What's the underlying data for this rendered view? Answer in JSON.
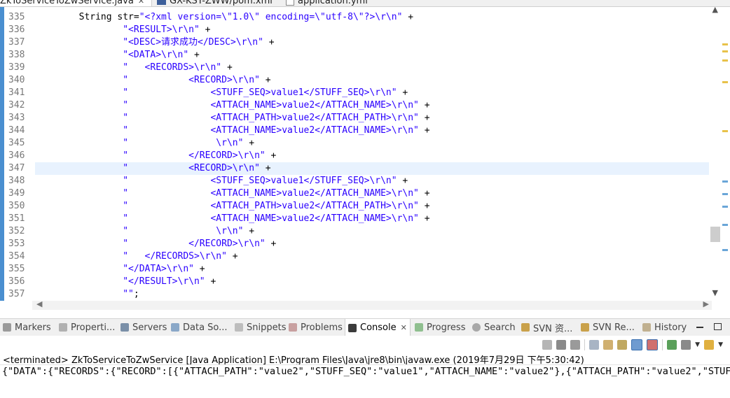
{
  "editor_tabs": [
    {
      "label": "ZkToServiceToZwService.java",
      "active": true
    },
    {
      "label": "GX-KSY-ZWW/pom.xml",
      "active": false
    },
    {
      "label": "application.yml",
      "active": false
    }
  ],
  "colors": {
    "string": "#2a00ff",
    "ruler": "#4a8fd0",
    "current_line": "#e8f2fe"
  },
  "line_numbers": [
    "335",
    "336",
    "337",
    "338",
    "339",
    "340",
    "341",
    "342",
    "343",
    "344",
    "345",
    "346",
    "347",
    "348",
    "349",
    "350",
    "351",
    "352",
    "353",
    "354",
    "355",
    "356",
    "357"
  ],
  "code": {
    "l335": {
      "pre": "        String str=",
      "str": "\"<?xml version=\\\"1.0\\\" encoding=\\\"utf-8\\\"?>\\r\\n\"",
      "post": " +"
    },
    "l336": {
      "pre": "                ",
      "str": "\"<RESULT>\\r\\n\"",
      "post": " +"
    },
    "l337": {
      "pre": "                ",
      "str": "\"<DESC>请求成功</DESC>\\r\\n\"",
      "post": " +"
    },
    "l338": {
      "pre": "                ",
      "str": "\"<DATA>\\r\\n\"",
      "post": " +"
    },
    "l339": {
      "pre": "                ",
      "str": "\"   <RECORDS>\\r\\n\"",
      "post": " +"
    },
    "l340": {
      "pre": "                ",
      "str": "\"           <RECORD>\\r\\n\"",
      "post": " +"
    },
    "l341": {
      "pre": "                ",
      "str": "\"               <STUFF_SEQ>value1</STUFF_SEQ>\\r\\n\"",
      "post": " +"
    },
    "l342": {
      "pre": "                ",
      "str": "\"               <ATTACH_NAME>value2</ATTACH_NAME>\\r\\n\"",
      "post": " +"
    },
    "l343": {
      "pre": "                ",
      "str": "\"               <ATTACH_PATH>value2</ATTACH_PATH>\\r\\n\"",
      "post": " +"
    },
    "l344": {
      "pre": "                ",
      "str": "\"               <ATTACH_NAME>value2</ATTACH_NAME>\\r\\n\"",
      "post": " +"
    },
    "l345": {
      "pre": "                ",
      "str": "\"                \\r\\n\"",
      "post": " +"
    },
    "l346": {
      "pre": "                ",
      "str": "\"           </RECORD>\\r\\n\"",
      "post": " +"
    },
    "l347": {
      "pre": "                ",
      "str": "\"           <RECORD>\\r\\n\"",
      "post": " +"
    },
    "l348": {
      "pre": "                ",
      "str": "\"               <STUFF_SEQ>value1</STUFF_SEQ>\\r\\n\"",
      "post": " +"
    },
    "l349": {
      "pre": "                ",
      "str": "\"               <ATTACH_NAME>value2</ATTACH_NAME>\\r\\n\"",
      "post": " +"
    },
    "l350": {
      "pre": "                ",
      "str": "\"               <ATTACH_PATH>value2</ATTACH_PATH>\\r\\n\"",
      "post": " +"
    },
    "l351": {
      "pre": "                ",
      "str": "\"               <ATTACH_NAME>value2</ATTACH_NAME>\\r\\n\"",
      "post": " +"
    },
    "l352": {
      "pre": "                ",
      "str": "\"                \\r\\n\"",
      "post": " +"
    },
    "l353": {
      "pre": "                ",
      "str": "\"           </RECORD>\\r\\n\"",
      "post": " +"
    },
    "l354": {
      "pre": "                ",
      "str": "\"   </RECORDS>\\r\\n\"",
      "post": " +"
    },
    "l355": {
      "pre": "                ",
      "str": "\"</DATA>\\r\\n\"",
      "post": " +"
    },
    "l356": {
      "pre": "                ",
      "str": "\"</RESULT>\\r\\n\"",
      "post": " +"
    },
    "l357": {
      "pre": "                ",
      "str": "\"\"",
      "post": ";"
    }
  },
  "view_tabs": [
    {
      "label": "Markers",
      "icon": "markers-icon"
    },
    {
      "label": "Properti...",
      "icon": "properties-icon"
    },
    {
      "label": "Servers",
      "icon": "servers-icon"
    },
    {
      "label": "Data So...",
      "icon": "data-source-icon"
    },
    {
      "label": "Snippets",
      "icon": "snippets-icon"
    },
    {
      "label": "Problems",
      "icon": "problems-icon"
    },
    {
      "label": "Console",
      "icon": "console-icon",
      "active": true
    },
    {
      "label": "Progress",
      "icon": "progress-icon"
    },
    {
      "label": "Search",
      "icon": "search-icon"
    },
    {
      "label": "SVN 资...",
      "icon": "svn-repo-icon"
    },
    {
      "label": "SVN Re...",
      "icon": "svn-icon"
    },
    {
      "label": "History",
      "icon": "history-icon"
    }
  ],
  "console": {
    "status": "<terminated> ZkToServiceToZwService [Java Application] E:\\Program Files\\Java\\jre8\\bin\\javaw.exe (2019年7月29日 下午5:30:42)",
    "output": "{\"DATA\":{\"RECORDS\":{\"RECORD\":[{\"ATTACH_PATH\":\"value2\",\"STUFF_SEQ\":\"value1\",\"ATTACH_NAME\":\"value2\"},{\"ATTACH_PATH\":\"value2\",\"STUF"
  }
}
